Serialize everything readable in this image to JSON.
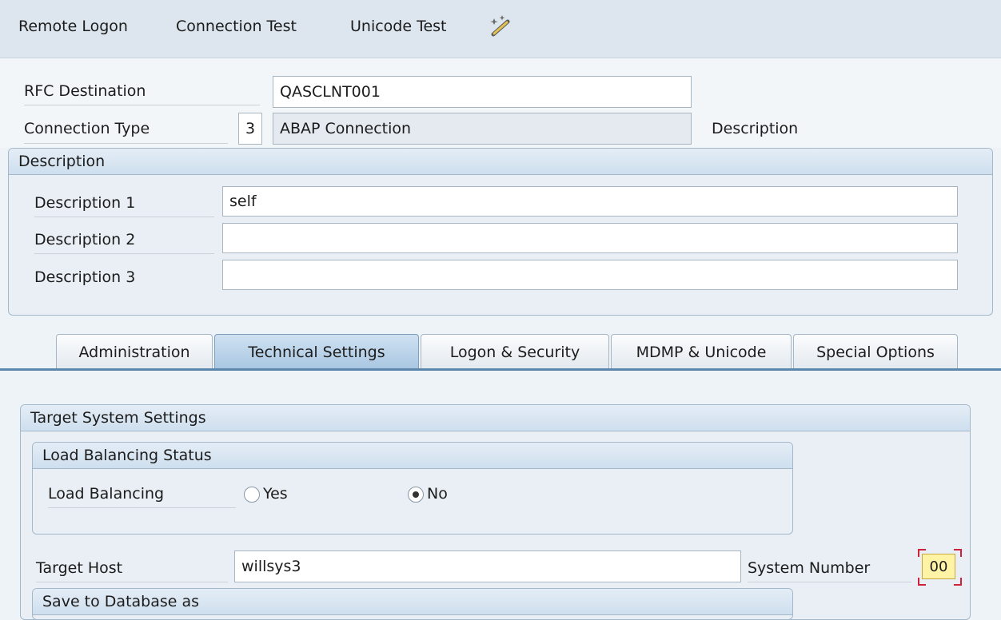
{
  "toolbar": {
    "items": [
      "Remote Logon",
      "Connection Test",
      "Unicode Test"
    ],
    "icon": "wand-icon"
  },
  "header": {
    "rfc_destination_label": "RFC Destination",
    "rfc_destination_value": "QASCLNT001",
    "connection_type_label": "Connection Type",
    "connection_type_code": "3",
    "connection_type_text": "ABAP Connection",
    "description_label": "Description"
  },
  "description_group": {
    "title": "Description",
    "fields": [
      {
        "label": "Description 1",
        "value": "self"
      },
      {
        "label": "Description 2",
        "value": ""
      },
      {
        "label": "Description 3",
        "value": ""
      }
    ]
  },
  "tabs": [
    {
      "label": "Administration",
      "active": false
    },
    {
      "label": "Technical Settings",
      "active": true
    },
    {
      "label": "Logon & Security",
      "active": false
    },
    {
      "label": "MDMP & Unicode",
      "active": false
    },
    {
      "label": "Special Options",
      "active": false
    }
  ],
  "technical": {
    "target_system_title": "Target System Settings",
    "load_balancing_status_title": "Load Balancing Status",
    "load_balancing_label": "Load Balancing",
    "option_yes": "Yes",
    "option_no": "No",
    "load_balancing_selected": "No",
    "target_host_label": "Target Host",
    "target_host_value": "willsys3",
    "system_number_label": "System Number",
    "system_number_value": "00",
    "save_group_title": "Save to Database as"
  },
  "colors": {
    "active_tab": "#a9c7e2",
    "tab_line": "#5d86ad",
    "focus_field": "#fff3a6",
    "focus_corner": "#d0223a"
  }
}
